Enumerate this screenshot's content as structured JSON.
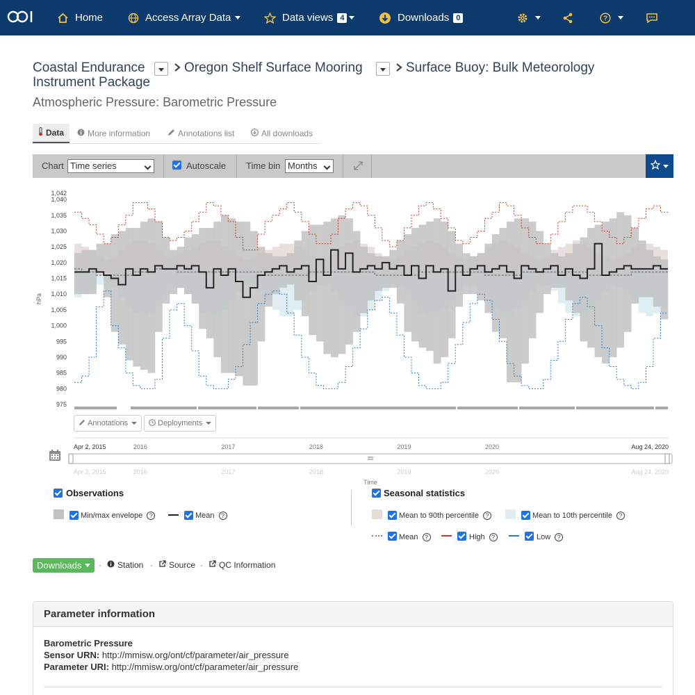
{
  "navbar": {
    "logo_text": "OOI",
    "home": "Home",
    "access": "Access Array Data",
    "dataviews": "Data views",
    "dataviews_count": "4",
    "downloads": "Downloads",
    "downloads_count": "0"
  },
  "breadcrumb": {
    "items": [
      "Coastal Endurance",
      "Oregon Shelf Surface Mooring",
      "Surface Buoy: Bulk Meteorology"
    ],
    "line2": "Instrument Package"
  },
  "subtitle": "Atmospheric Pressure: Barometric Pressure",
  "tabs": [
    "Data",
    "More information",
    "Annotations list",
    "All downloads"
  ],
  "toolbar": {
    "chart_label": "Chart",
    "chart_value": "Time series",
    "autoscale": "Autoscale",
    "timebin_label": "Time bin",
    "timebin_value": "Months"
  },
  "chart_data": {
    "type": "line",
    "ylabel": "hPa",
    "xlabel": "Time",
    "y_ticks": [
      "975",
      "980",
      "985",
      "990",
      "995",
      "1,000",
      "1,005",
      "1,010",
      "1,015",
      "1,020",
      "1,025",
      "1,030",
      "1,035",
      "1,040",
      "1,042"
    ],
    "ylim": [
      975,
      1042
    ],
    "x_start": "2015-04",
    "x_ticks": [
      "2016",
      "2017",
      "2018",
      "2019",
      "2020"
    ],
    "navigator_start": "Apr 2, 2015",
    "navigator_end": "Aug 24, 2020",
    "colors": {
      "envelope": "#c2c2c2",
      "mean": "#222222",
      "seasonal_mean": "#7a8190",
      "high": "#c0392b",
      "low": "#2e7bbf",
      "to90": "#e7dbd9",
      "to10": "#dcecf1"
    },
    "series": [
      {
        "name": "Min/max envelope",
        "min": [
          1010,
          1010,
          1010,
          1017,
          1009,
          998,
          994,
          989,
          987,
          986,
          985,
          998,
          1007,
          1010,
          1012,
          1010,
          1007,
          999,
          996,
          990,
          985,
          985,
          984,
          981,
          981,
          995,
          1006,
          1010,
          1012,
          1013,
          1008,
          1003,
          997,
          995,
          991,
          990,
          991,
          994,
          998,
          1004,
          1008,
          1011,
          1012,
          1012,
          1007,
          998,
          995,
          993,
          992,
          988,
          990,
          996,
          1006,
          1010,
          1010,
          1008,
          1004,
          998,
          996,
          982,
          982,
          988,
          996,
          1004,
          1010,
          1012,
          1012,
          1008,
          1004,
          995,
          993,
          990,
          988,
          990,
          993,
          998,
          1007,
          1009,
          1009,
          1006,
          1002
        ]
      },
      {
        "name": "Min/max envelope",
        "max": [
          1023,
          1024,
          1024,
          1026,
          1026,
          1029,
          1030,
          1031,
          1031,
          1033,
          1034,
          1033,
          1028,
          1024,
          1025,
          1028,
          1029,
          1031,
          1031,
          1033,
          1035,
          1034,
          1033,
          1033,
          1030,
          1025,
          1023,
          1022,
          1022,
          1023,
          1027,
          1030,
          1032,
          1032,
          1033,
          1034,
          1035,
          1034,
          1030,
          1025,
          1023,
          1022,
          1022,
          1024,
          1027,
          1029,
          1031,
          1032,
          1033,
          1034,
          1033,
          1030,
          1026,
          1023,
          1022,
          1023,
          1026,
          1029,
          1031,
          1033,
          1034,
          1034,
          1033,
          1030,
          1026,
          1023,
          1022,
          1023,
          1026,
          1028,
          1031,
          1032,
          1033,
          1034,
          1036,
          1035,
          1031,
          1027,
          1024,
          1022,
          1021
        ]
      },
      {
        "name": "Mean",
        "values": [
          1017,
          1017,
          1018,
          1017,
          1016,
          1015,
          1013,
          1018,
          1016,
          1018,
          1017,
          1019,
          1018,
          1018,
          1019,
          1018,
          1019,
          1017,
          1012,
          1018,
          1016,
          1018,
          1014,
          1009,
          1012,
          1016,
          1017,
          1018,
          1019,
          1017,
          1018,
          1019,
          1014,
          1021,
          1016,
          1024,
          1018,
          1023,
          1017,
          1018,
          1019,
          1018,
          1020,
          1018,
          1019,
          1016,
          1019,
          1015,
          1019,
          1017,
          1018,
          1011,
          1019,
          1016,
          1018,
          1019,
          1017,
          1018,
          1019,
          1017,
          1015,
          1019,
          1018,
          1017,
          1018,
          1019,
          1016,
          1018,
          1016,
          1015,
          1018,
          1026,
          1016,
          1017,
          1018,
          1019,
          1018,
          1018,
          1018,
          1019,
          1018
        ]
      },
      {
        "name": "Seasonal mean",
        "values": [
          1018,
          1017,
          1017,
          1016,
          1016,
          1016,
          1016,
          1016,
          1017,
          1017,
          1017,
          1018,
          1018,
          1018,
          1017,
          1017,
          1017,
          1017,
          1017,
          1017,
          1017,
          1017,
          1017,
          1017,
          1017,
          1017,
          1016,
          1016,
          1016,
          1016,
          1016,
          1016,
          1017,
          1017,
          1017,
          1017,
          1017,
          1017,
          1017,
          1017,
          1017,
          1016,
          1016,
          1016,
          1016,
          1016,
          1016,
          1017,
          1017,
          1017,
          1017,
          1017,
          1017,
          1017,
          1017,
          1017,
          1016,
          1016,
          1016,
          1016,
          1016,
          1017,
          1017,
          1017,
          1017,
          1017,
          1017,
          1017,
          1017,
          1017,
          1016,
          1016,
          1016,
          1016,
          1016,
          1016,
          1017,
          1017,
          1017,
          1017,
          1017
        ]
      },
      {
        "name": "High",
        "values": [
          1036,
          1034,
          1032,
          1029,
          1026,
          1028,
          1032,
          1035,
          1039,
          1039,
          1037,
          1033,
          1028,
          1027,
          1028,
          1030,
          1033,
          1036,
          1039,
          1038,
          1035,
          1033,
          1028,
          1024,
          1024,
          1029,
          1033,
          1035,
          1037,
          1039,
          1036,
          1033,
          1029,
          1026,
          1026,
          1029,
          1034,
          1037,
          1039,
          1038,
          1035,
          1031,
          1027,
          1025,
          1027,
          1031,
          1035,
          1038,
          1039,
          1037,
          1034,
          1031,
          1027,
          1026,
          1028,
          1030,
          1034,
          1036,
          1039,
          1038,
          1035,
          1031,
          1028,
          1026,
          1026,
          1029,
          1033,
          1036,
          1038,
          1038,
          1036,
          1033,
          1030,
          1028,
          1026,
          1028,
          1031,
          1034,
          1037,
          1038,
          1036
        ]
      },
      {
        "name": "Low",
        "values": [
          982,
          984,
          990,
          1006,
          1011,
          1000,
          993,
          985,
          981,
          980,
          980,
          983,
          996,
          1005,
          1007,
          1000,
          992,
          984,
          981,
          980,
          980,
          983,
          987,
          994,
          1001,
          1007,
          1010,
          1011,
          1010,
          1004,
          997,
          990,
          985,
          981,
          980,
          980,
          982,
          987,
          993,
          999,
          1005,
          1008,
          1009,
          1004,
          997,
          990,
          985,
          981,
          980,
          980,
          982,
          988,
          994,
          1001,
          1007,
          1010,
          1008,
          1002,
          995,
          988,
          984,
          981,
          980,
          980,
          983,
          989,
          995,
          1002,
          1007,
          1009,
          1006,
          1000,
          993,
          987,
          983,
          981,
          980,
          982,
          987,
          996,
          1004
        ]
      },
      {
        "name": "Mean to 90th percentile",
        "values": [
          1026,
          1025,
          1024,
          1022,
          1021,
          1022,
          1024,
          1026,
          1027,
          1027,
          1026,
          1024,
          1022,
          1022,
          1023,
          1024,
          1025,
          1026,
          1027,
          1027,
          1025,
          1024,
          1022,
          1021,
          1022,
          1023,
          1024,
          1025,
          1026,
          1026,
          1025,
          1024,
          1022,
          1021,
          1022,
          1023,
          1025,
          1026,
          1027,
          1026,
          1025,
          1023,
          1022,
          1021,
          1022,
          1024,
          1025,
          1026,
          1027,
          1026,
          1025,
          1023,
          1022,
          1021,
          1022,
          1023,
          1025,
          1026,
          1027,
          1026,
          1025,
          1023,
          1022,
          1021,
          1022,
          1024,
          1025,
          1026,
          1027,
          1026,
          1025,
          1023,
          1022,
          1021,
          1022,
          1023,
          1025,
          1026,
          1026,
          1025,
          1024
        ]
      },
      {
        "name": "Mean to 10th percentile",
        "values": [
          1009,
          1010,
          1011,
          1013,
          1014,
          1012,
          1009,
          1006,
          1004,
          1003,
          1004,
          1007,
          1010,
          1012,
          1012,
          1010,
          1007,
          1004,
          1003,
          1003,
          1005,
          1008,
          1011,
          1013,
          1013,
          1011,
          1008,
          1005,
          1003,
          1003,
          1005,
          1008,
          1011,
          1013,
          1013,
          1011,
          1008,
          1005,
          1003,
          1003,
          1005,
          1008,
          1011,
          1013,
          1012,
          1010,
          1007,
          1004,
          1003,
          1003,
          1005,
          1008,
          1011,
          1013,
          1013,
          1011,
          1008,
          1005,
          1003,
          1003,
          1005,
          1008,
          1011,
          1013,
          1013,
          1011,
          1007,
          1004,
          1003,
          1003,
          1005,
          1008,
          1011,
          1013,
          1012,
          1010,
          1007,
          1004,
          1003,
          1004,
          1006
        ]
      }
    ]
  },
  "chart_buttons": {
    "annotations": "Annotations",
    "deployments": "Deployments"
  },
  "legend": {
    "observations_title": "Observations",
    "minmax": "Min/max envelope",
    "mean": "Mean",
    "seasonal_title": "Seasonal statistics",
    "to90": "Mean to 90th percentile",
    "to10": "Mean to 10th percentile",
    "s_mean": "Mean",
    "s_high": "High",
    "s_low": "Low"
  },
  "links": {
    "downloads": "Downloads",
    "station": "Station",
    "source": "Source",
    "qc": "QC Information"
  },
  "param_info": {
    "heading": "Parameter information",
    "name": "Barometric Pressure",
    "sensor_label": "Sensor URN:",
    "sensor_value": "http://mmisw.org/ont/cf/parameter/air_pressure",
    "uri_label": "Parameter URI:",
    "uri_value": "http://mmisw.org/ont/cf/parameter/air_pressure"
  }
}
